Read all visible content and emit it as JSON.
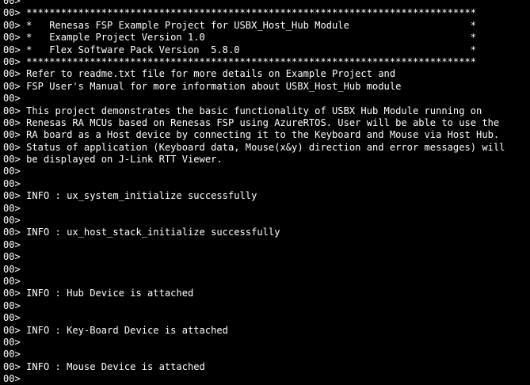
{
  "prompt": "00>",
  "lines": [
    {
      "text": ""
    },
    {
      "text": " ******************************************************************************"
    },
    {
      "text": " *   Renesas FSP Example Project for USBX_Host_Hub Module                     *"
    },
    {
      "text": " *   Example Project Version 1.0                                              *"
    },
    {
      "text": " *   Flex Software Pack Version  5.8.0                                        *"
    },
    {
      "text": " ******************************************************************************"
    },
    {
      "text": " Refer to readme.txt file for more details on Example Project and"
    },
    {
      "text": " FSP User's Manual for more information about USBX_Host_Hub module"
    },
    {
      "text": ""
    },
    {
      "text": " This project demonstrates the basic functionality of USBX Hub Module running on"
    },
    {
      "text": " Renesas RA MCUs based on Renesas FSP using AzureRTOS. User will be able to use the"
    },
    {
      "text": " RA board as a Host device by connecting it to the Keyboard and Mouse via Host Hub."
    },
    {
      "text": " Status of application (Keyboard data, Mouse(x&y) direction and error messages) will"
    },
    {
      "text": " be displayed on J-Link RTT Viewer."
    },
    {
      "text": ""
    },
    {
      "text": ""
    },
    {
      "text": " INFO : ux_system_initialize successfully"
    },
    {
      "text": ""
    },
    {
      "text": ""
    },
    {
      "text": " INFO : ux_host_stack_initialize successfully"
    },
    {
      "text": ""
    },
    {
      "text": ""
    },
    {
      "text": ""
    },
    {
      "text": ""
    },
    {
      "text": " INFO : Hub Device is attached"
    },
    {
      "text": ""
    },
    {
      "text": ""
    },
    {
      "text": " INFO : Key-Board Device is attached"
    },
    {
      "text": ""
    },
    {
      "text": ""
    },
    {
      "text": " INFO : Mouse Device is attached"
    },
    {
      "text": ""
    },
    {
      "text": ""
    }
  ]
}
